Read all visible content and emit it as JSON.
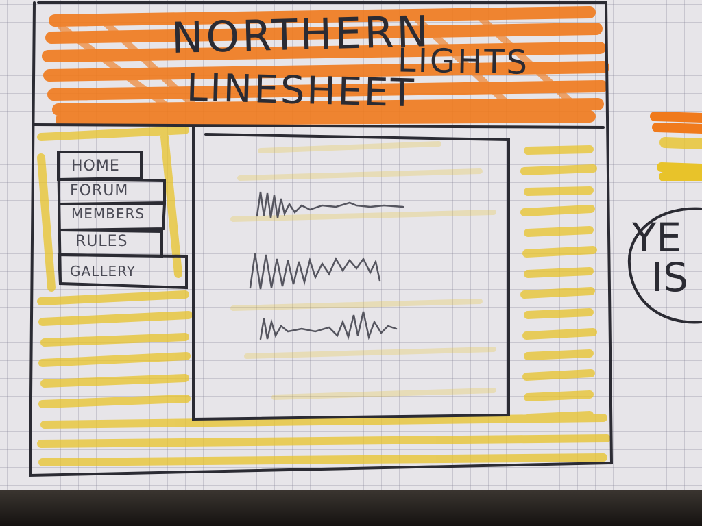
{
  "header": {
    "title_line1": "NORTHERN",
    "title_line2": "LIGHTS",
    "title_line3": "LINESHEET"
  },
  "nav": {
    "items": [
      {
        "label": "HOME"
      },
      {
        "label": "FORUM"
      },
      {
        "label": "MEMBERS"
      },
      {
        "label": "RULES"
      },
      {
        "label": "GALLERY"
      }
    ]
  },
  "side_note": {
    "line1": "YE",
    "line2": "IS"
  },
  "colors": {
    "header_marker": "#f07a1c",
    "body_marker": "#e8c32a",
    "ink": "#2b2b33",
    "paper": "#e7e5e9"
  }
}
